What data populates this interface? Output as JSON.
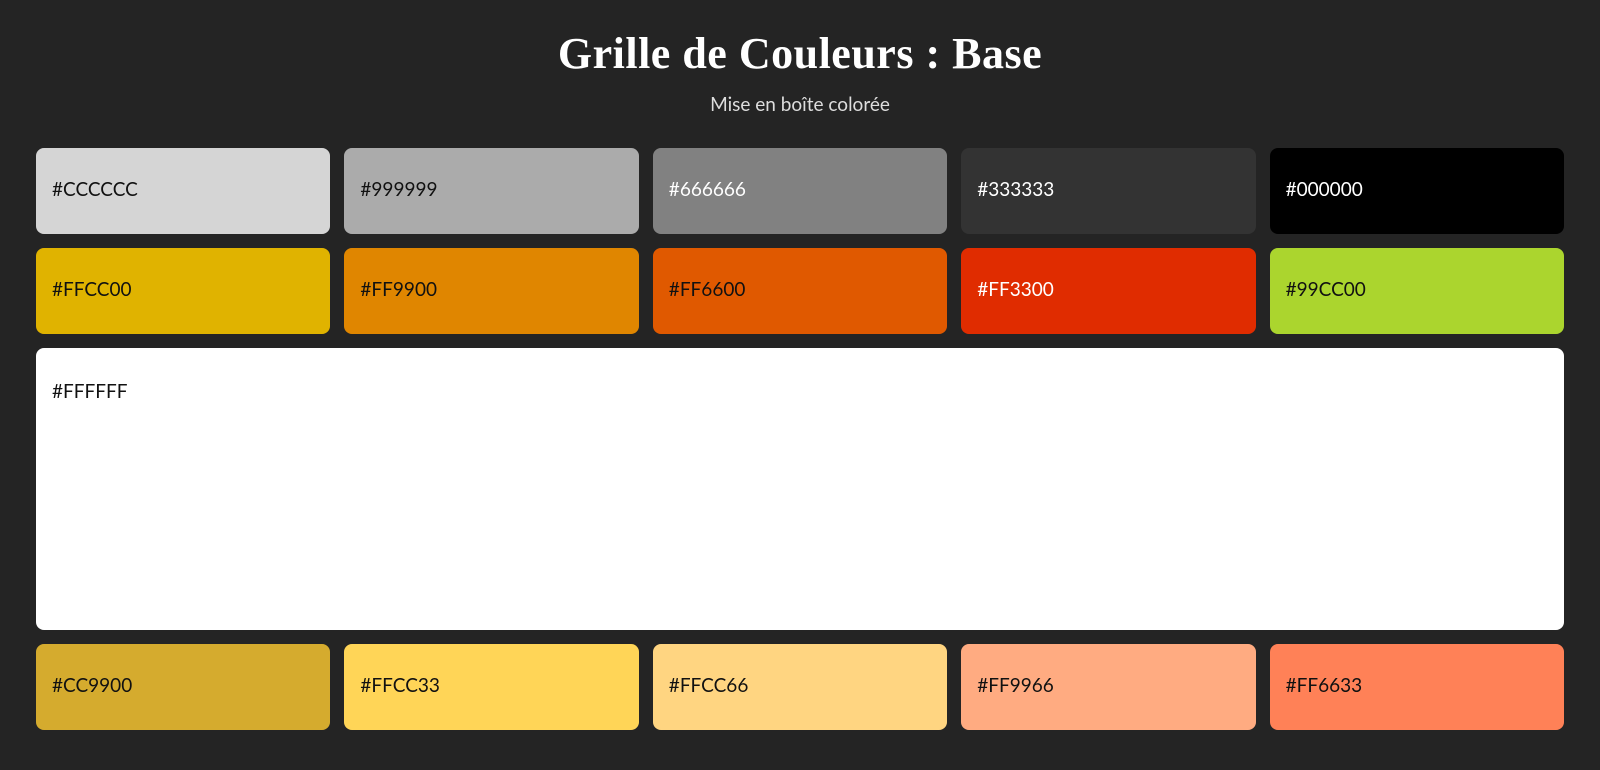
{
  "header": {
    "title": "Grille de Couleurs : Base",
    "subtitle": "Mise en boîte colorée"
  },
  "swatches": [
    {
      "label": "#CCCCCC",
      "color": "#CCCCCC",
      "text": "dark",
      "overlay": "light",
      "wide": false
    },
    {
      "label": "#999999",
      "color": "#999999",
      "text": "dark",
      "overlay": "light",
      "wide": false
    },
    {
      "label": "#666666",
      "color": "#666666",
      "text": "light",
      "overlay": "light",
      "wide": false
    },
    {
      "label": "#333333",
      "color": "#333333",
      "text": "light",
      "overlay": "none",
      "wide": false
    },
    {
      "label": "#000000",
      "color": "#000000",
      "text": "light",
      "overlay": "none",
      "wide": false
    },
    {
      "label": "#FFCC00",
      "color": "#FFCC00",
      "text": "dark",
      "overlay": "dark",
      "wide": false
    },
    {
      "label": "#FF9900",
      "color": "#FF9900",
      "text": "dark",
      "overlay": "dark",
      "wide": false
    },
    {
      "label": "#FF6600",
      "color": "#FF6600",
      "text": "dark",
      "overlay": "dark",
      "wide": false
    },
    {
      "label": "#FF3300",
      "color": "#FF3300",
      "text": "light",
      "overlay": "dark",
      "wide": false
    },
    {
      "label": "#99CC00",
      "color": "#99CC00",
      "text": "dark",
      "overlay": "light",
      "wide": false
    },
    {
      "label": "#FFFFFF",
      "color": "#FFFFFF",
      "text": "dark",
      "overlay": "none",
      "wide": true
    },
    {
      "label": "#CC9900",
      "color": "#CC9900",
      "text": "dark",
      "overlay": "light",
      "wide": false
    },
    {
      "label": "#FFCC33",
      "color": "#FFCC33",
      "text": "dark",
      "overlay": "light",
      "wide": false
    },
    {
      "label": "#FFCC66",
      "color": "#FFCC66",
      "text": "dark",
      "overlay": "light",
      "wide": false
    },
    {
      "label": "#FF9966",
      "color": "#FF9966",
      "text": "dark",
      "overlay": "light",
      "wide": false
    },
    {
      "label": "#FF6633",
      "color": "#FF6633",
      "text": "dark",
      "overlay": "light",
      "wide": false
    }
  ]
}
